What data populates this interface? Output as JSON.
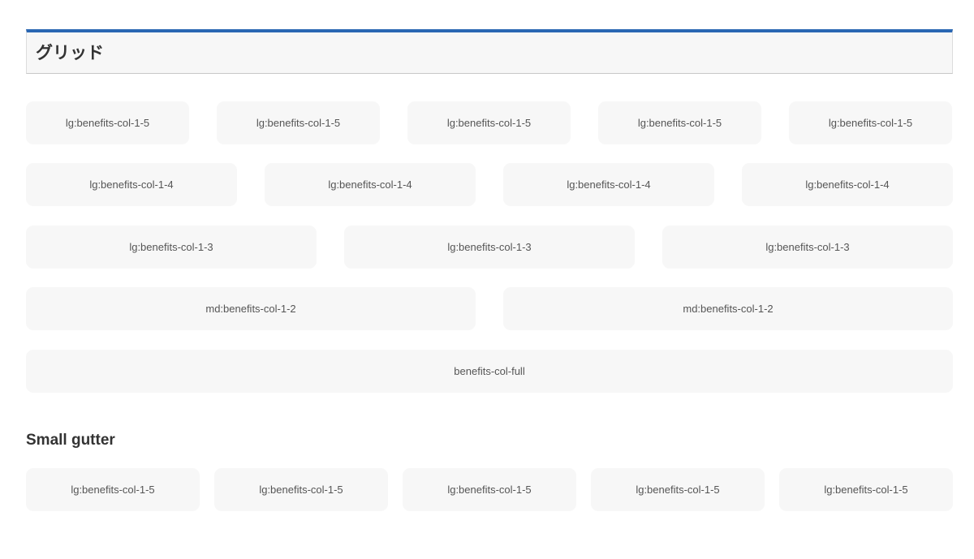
{
  "heading": {
    "title": "グリッド"
  },
  "grid": {
    "row_fifths": [
      "lg:benefits-col-1-5",
      "lg:benefits-col-1-5",
      "lg:benefits-col-1-5",
      "lg:benefits-col-1-5",
      "lg:benefits-col-1-5"
    ],
    "row_quarters": [
      "lg:benefits-col-1-4",
      "lg:benefits-col-1-4",
      "lg:benefits-col-1-4",
      "lg:benefits-col-1-4"
    ],
    "row_thirds": [
      "lg:benefits-col-1-3",
      "lg:benefits-col-1-3",
      "lg:benefits-col-1-3"
    ],
    "row_halves": [
      "md:benefits-col-1-2",
      "md:benefits-col-1-2"
    ],
    "row_full": [
      "benefits-col-full"
    ]
  },
  "small_gutter": {
    "title": "Small gutter",
    "cells": [
      "lg:benefits-col-1-5",
      "lg:benefits-col-1-5",
      "lg:benefits-col-1-5",
      "lg:benefits-col-1-5",
      "lg:benefits-col-1-5"
    ]
  },
  "colors": {
    "accent": "#2a67b3",
    "cell_background": "#f7f7f7",
    "text": "#333333"
  }
}
